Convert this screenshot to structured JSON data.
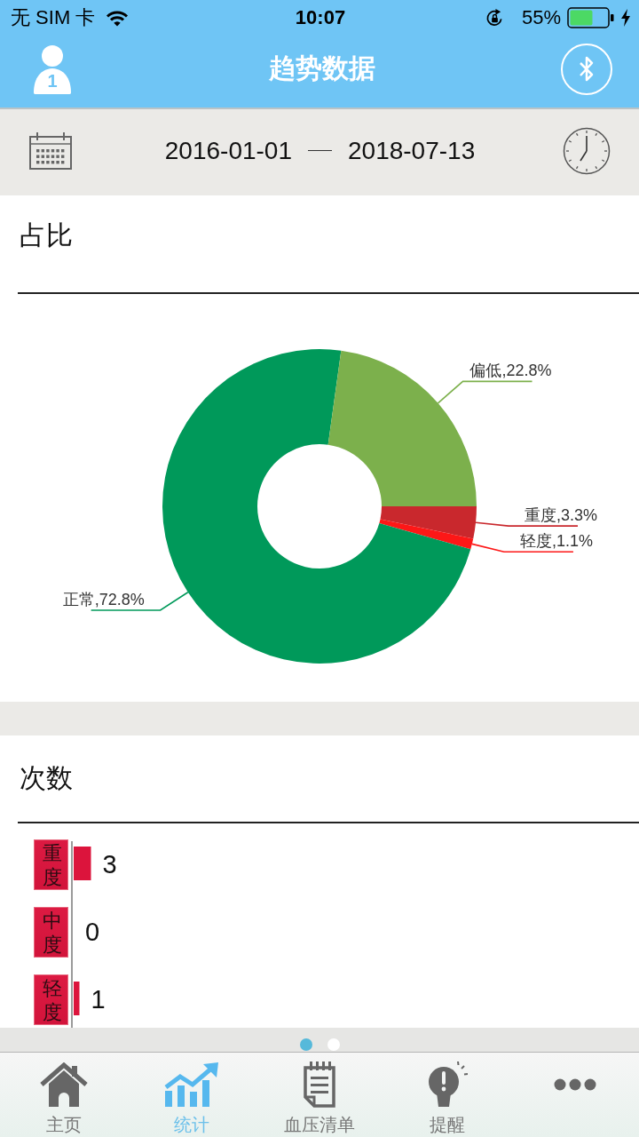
{
  "status_bar": {
    "carrier": "无 SIM 卡",
    "time": "10:07",
    "battery": "55%"
  },
  "header": {
    "title": "趋势数据",
    "user_badge": "1"
  },
  "date_range": {
    "start": "2016-01-01",
    "end": "2018-07-13"
  },
  "sections": [
    {
      "title": "占比",
      "chart_data": {
        "type": "donut",
        "values": [
          3.3,
          1.1,
          72.8,
          22.8
        ],
        "colors": [
          "#c9282d",
          "#fd1717",
          "#00995a",
          "#7cb04c"
        ],
        "value_labels": [
          "重度,3.3%",
          "轻度,1.1%",
          "正常,72.8%",
          "偏低,22.8%"
        ]
      }
    },
    {
      "title": "次数",
      "chart_data": {
        "type": "bar",
        "orientation": "horizontal",
        "categories": [
          "重度",
          "中度",
          "轻度"
        ],
        "series": [
          {
            "color": "#dc143c",
            "values": [
              3,
              0,
              1
            ]
          }
        ],
        "data_labels": true
      }
    }
  ],
  "page_dots": [
    {
      "selected": true
    },
    {
      "selected": false
    }
  ],
  "tabs": [
    {
      "label": "主页",
      "selected": false
    },
    {
      "label": "统计",
      "selected": true
    },
    {
      "label": "血压清单",
      "selected": false
    },
    {
      "label": "提醒",
      "selected": false
    },
    {
      "selected": false
    }
  ]
}
